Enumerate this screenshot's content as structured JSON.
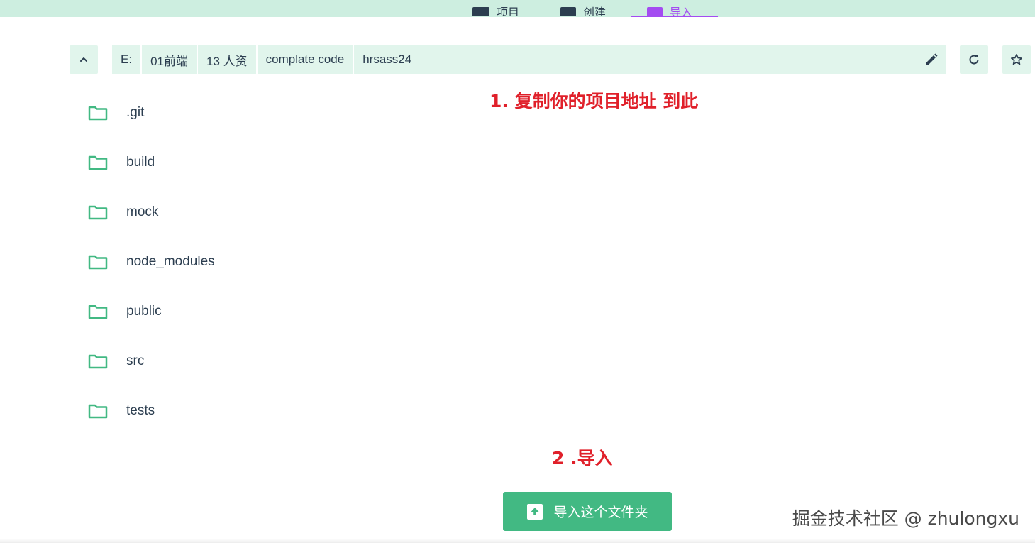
{
  "nav": {
    "tabs": [
      {
        "label": "项目",
        "icon": "list-icon"
      },
      {
        "label": "创建",
        "icon": "plus-box-icon"
      },
      {
        "label": "导入",
        "icon": "import-icon",
        "active": true
      }
    ]
  },
  "path": {
    "crumbs": [
      "E:",
      "01前端",
      "13 人资",
      "complate code",
      "hrsass24"
    ],
    "edit_icon": "pencil-icon"
  },
  "toolbar": {
    "up_icon": "chevron-up-icon",
    "refresh_icon": "refresh-icon",
    "favorite_icon": "star-icon"
  },
  "folders": [
    ".git",
    "build",
    "mock",
    "node_modules",
    "public",
    "src",
    "tests"
  ],
  "annotations": {
    "step1": "1. 复制你的项目地址 到此",
    "step2": "2 .导入"
  },
  "import_button": {
    "label": "导入这个文件夹",
    "icon": "upload-box-icon"
  },
  "watermark": "掘金技术社区 @ zhulongxu",
  "colors": {
    "accent_green": "#42b983",
    "topbar_bg": "#cdeee0",
    "pathbar_bg": "#e1f5ec",
    "active_tab": "#a44cf1",
    "annotation_red": "#e0202a"
  }
}
